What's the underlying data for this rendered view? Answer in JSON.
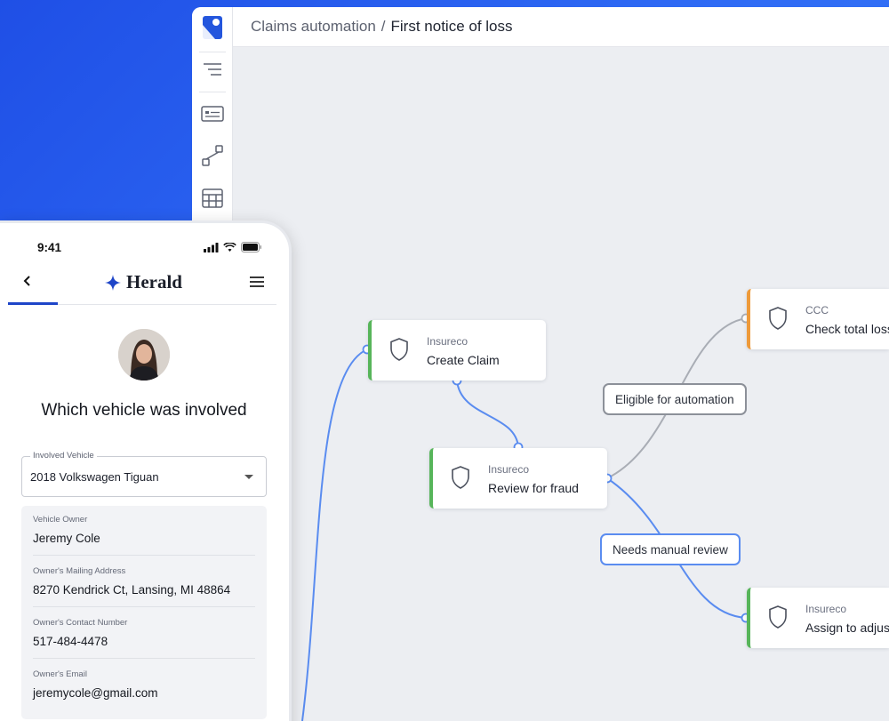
{
  "app": {
    "breadcrumb": {
      "root": "Claims automation",
      "separator": "/",
      "current": "First notice of loss"
    },
    "rail_icons": [
      "brand-logo",
      "outline-icon",
      "card-icon",
      "workflow-icon",
      "table-icon"
    ]
  },
  "workflow": {
    "nodes": {
      "create_claim": {
        "provider": "Insureco",
        "title": "Create Claim",
        "status_color": "#57b55a"
      },
      "review_fraud": {
        "provider": "Insureco",
        "title": "Review for fraud",
        "status_color": "#57b55a"
      },
      "check_total_loss": {
        "provider": "CCC",
        "title": "Check total loss",
        "status_color": "#ee9a3a"
      },
      "assign_adjuster": {
        "provider": "Insureco",
        "title": "Assign to adjuster",
        "status_color": "#57b55a"
      }
    },
    "conditions": {
      "eligible": "Eligible for automation",
      "manual": "Needs manual review"
    }
  },
  "phone": {
    "time": "9:41",
    "brand": "Herald",
    "question": "Which vehicle was involved",
    "vehicle_select": {
      "label": "Involved Vehicle",
      "value": "2018 Volkswagen Tiguan"
    },
    "details": [
      {
        "label": "Vehicle Owner",
        "value": "Jeremy Cole"
      },
      {
        "label": "Owner's Mailing Address",
        "value": "8270 Kendrick Ct, Lansing, MI 48864"
      },
      {
        "label": "Owner's Contact Number",
        "value": "517-484-4478"
      },
      {
        "label": "Owner's Email",
        "value": "jeremycole@gmail.com"
      }
    ]
  },
  "colors": {
    "background": "#2f6bf5",
    "wire_blue": "#5a8cf0",
    "wire_gray": "#a9adb5",
    "accent": "#1e45c8"
  }
}
